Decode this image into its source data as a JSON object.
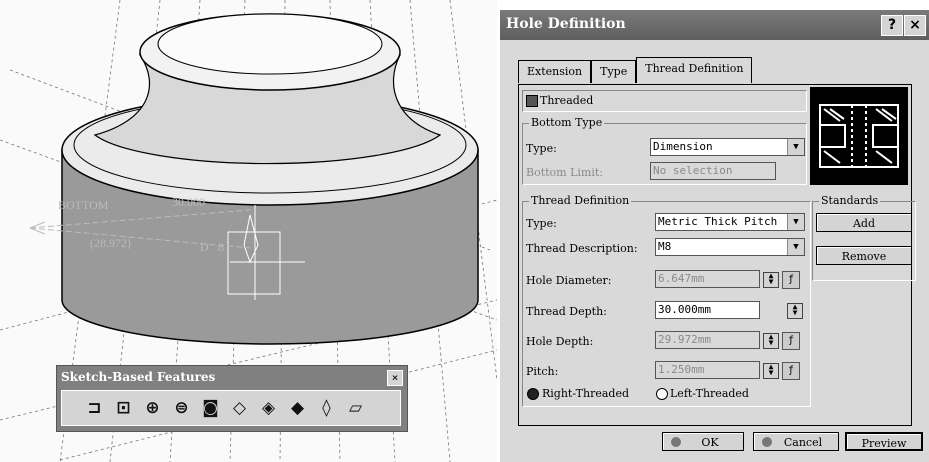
{
  "viewport": {
    "dimension_bottom_label": "BOTTOM",
    "dimension_depth_value": "30.000",
    "dimension_hole_depth_value": "(28.972)",
    "dimension_diameter_label": "D",
    "dimension_diameter_value": "8"
  },
  "toolbar": {
    "title": "Sketch-Based Features",
    "close_label": "×",
    "icons": [
      "pad-icon",
      "pocket-icon",
      "shaft-icon",
      "groove-icon",
      "hole-icon",
      "rib-icon",
      "slot-icon",
      "stiffener-icon",
      "loft-icon",
      "removed-loft-icon"
    ]
  },
  "dialog": {
    "title": "Hole Definition",
    "help_label": "?",
    "close_label": "×",
    "tabs": [
      "Extension",
      "Type",
      "Thread Definition"
    ],
    "threaded_label": "Threaded",
    "bottom_type": {
      "group_title": "Bottom Type",
      "type_label": "Type:",
      "type_value": "Dimension",
      "limit_label": "Bottom Limit:",
      "limit_value": "No selection"
    },
    "thread_definition": {
      "group_title": "Thread Definition",
      "type_label": "Type:",
      "type_value": "Metric Thick Pitch",
      "desc_label": "Thread Description:",
      "desc_value": "M8",
      "hole_diameter_label": "Hole Diameter:",
      "hole_diameter_value": "6.647mm",
      "thread_depth_label": "Thread Depth:",
      "thread_depth_value": "30.000mm",
      "hole_depth_label": "Hole Depth:",
      "hole_depth_value": "29.972mm",
      "pitch_label": "Pitch:",
      "pitch_value": "1.250mm",
      "right_threaded_label": "Right-Threaded",
      "left_threaded_label": "Left-Threaded"
    },
    "standards": {
      "group_title": "Standards",
      "add_label": "Add",
      "remove_label": "Remove"
    },
    "ok_label": "OK",
    "cancel_label": "Cancel",
    "preview_label": "Preview"
  }
}
